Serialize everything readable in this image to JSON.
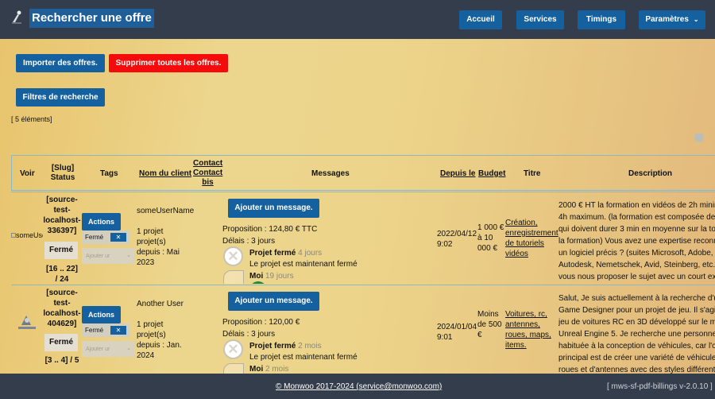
{
  "header": {
    "title": "Rechercher une offre",
    "nav": {
      "home": "Accueil",
      "services": "Services",
      "timings": "Timings",
      "settings": "Paramètres"
    }
  },
  "toolbar": {
    "import": "Importer des offres.",
    "delete_all": "Supprimer toutes les offres.",
    "filters": "Filtres de recherche",
    "count": "[ 5 éléments]"
  },
  "table": {
    "headers": {
      "voir": "Voir",
      "slug1": "[Slug]",
      "slug2": "Status",
      "tags": "Tags",
      "client": "Nom du client",
      "contact1": "Contact",
      "contact2": "Contact",
      "contact3": "bis",
      "messages": "Messages",
      "since": "Depuis le",
      "budget": "Budget",
      "title": "Titre",
      "description": "Description"
    },
    "rows": [
      {
        "voir_alt": "someUse",
        "slug": [
          "[source-",
          "test-",
          "localhost-",
          "336397]"
        ],
        "status": "Fermé",
        "range": [
          "[16 .. 22]",
          "/ 24"
        ],
        "actions": "Actions",
        "tag": "Fermé",
        "tag_remove": "✕",
        "add_tag": "Ajouter ur",
        "client": [
          "someUserName",
          "",
          "1 projet",
          "projet(s)",
          "depuis : Mai",
          "2023"
        ],
        "msg_button": "Ajouter un message.",
        "proposition": "Proposition : 124,80 € TTC",
        "delay": "Délais : 3 jours",
        "event_title": "Projet fermé",
        "event_time": "4 jours",
        "event_text": "Le projet est maintenant fermé",
        "moi": "Moi",
        "moi_time": "19 jours",
        "date": [
          "2022/04/12",
          "9:02"
        ],
        "budget": [
          "1 000 €",
          "à 10",
          "000 €"
        ],
        "titre": [
          "Création,",
          "enregistrement",
          "de tutoriels",
          "vidéos"
        ],
        "description": [
          "2000 € HT la formation en vidéos de 2h minim",
          "4h maximum. (la formation est composée de",
          "qui doivent durer 3 min en moyenne sur la totalit",
          "la formation) Vous avez une expertise reconnu",
          "un logiciel précis ? (suites Microsoft, Adobe,",
          "Autodesk, Nemetschek, Avid, Steinberg, etc.",
          "vous nous proposer le sujet avec un court extr"
        ]
      },
      {
        "voir_alt": "",
        "slug": [
          "[source-",
          "test-",
          "localhost-",
          "404629]"
        ],
        "status": "Fermé",
        "range": [
          "[3 .. 4] / 5"
        ],
        "actions": "Actions",
        "tag": "Fermé",
        "tag_remove": "✕",
        "add_tag": "Ajouter ur",
        "client": [
          "Another User",
          "",
          "1 projet",
          "projet(s)",
          "depuis : Jan.",
          "2024"
        ],
        "msg_button": "Ajouter un message.",
        "proposition": "Proposition : 120,00 €",
        "delay": "Délais : 3 jours",
        "event_title": "Projet fermé",
        "event_time": "2 mois",
        "event_text": "Le projet est maintenant fermé",
        "moi": "Moi",
        "moi_time": "2 mois",
        "date": [
          "2024/01/04",
          "9:01"
        ],
        "budget": [
          "Moins",
          "de 500",
          "€"
        ],
        "titre": [
          "Voitures, rc,",
          "antennes,",
          "roues, maps,",
          "items."
        ],
        "description": [
          "Salut, Je suis actuellement à la recherche d'u",
          "Game Designer pour un projet de jeu. Il s'agit d",
          "jeu de voitures RC en 3D développé sur le mo",
          "Unreal Engine 5. Je recherche une personne",
          "habituée à la conception de véhicules, car l'o",
          "principal est de créer une variété de véhicules",
          "roues et d'antennes avec des styles différents"
        ]
      }
    ]
  },
  "footer": {
    "copyright": "© Monwoo 2017-2024 (service@monwoo.com)",
    "version": "[ mws-sf-pdf-billings v-2.0.10 ]"
  },
  "icons": [
    "app-logo-icon",
    "chevron-down-icon",
    "close-icon",
    "avatar-icon"
  ]
}
